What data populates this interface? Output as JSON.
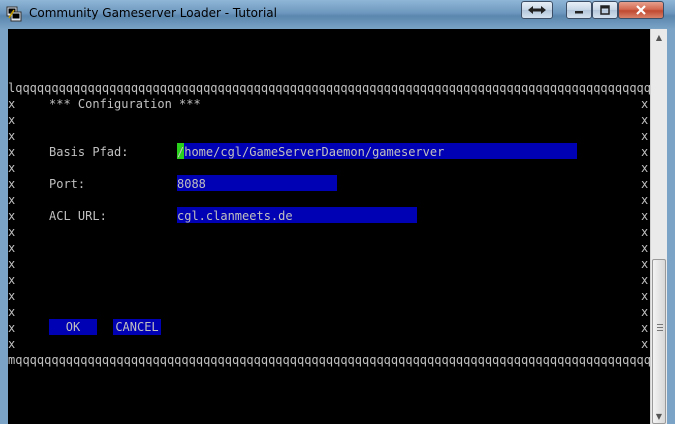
{
  "window": {
    "title": "Community Gameserver Loader - Tutorial",
    "icons": {
      "app": "putty-icon",
      "extra": "move-arrows-icon",
      "minimize": "minimize-icon",
      "maximize": "maximize-icon",
      "close": "close-icon"
    }
  },
  "terminal": {
    "border_top": "lqqqqqqqqqqqqqqqqqqqqqqqqqqqqqqqqqqqqqqqqqqqqqqqqqqqqqqqqqqqqqqqqqqqqqqqqqqqqqqqqqqqqqqqqk",
    "border_bottom": "mqqqqqqqqqqqqqqqqqqqqqqqqqqqqqqqqqqqqqqqqqqqqqqqqqqqqqqqqqqqqqqqqqqqqqqqqqqqqqqqqqqqqqqqqqj",
    "border_side": "x",
    "heading": "*** Configuration ***",
    "fields": {
      "basis_pfad": {
        "label": "Basis Pfad:",
        "value": "/home/cgl/GameServerDaemon/gameserver"
      },
      "port": {
        "label": "Port:",
        "value": "8088"
      },
      "acl_url": {
        "label": "ACL URL:",
        "value": "cgl.clanmeets.de"
      }
    },
    "buttons": {
      "ok": "OK",
      "cancel": "CANCEL"
    }
  },
  "colors": {
    "terminal_bg": "#000000",
    "terminal_text": "#c0c0c0",
    "field_bg": "#0000b4",
    "cursor": "#29d11c"
  }
}
